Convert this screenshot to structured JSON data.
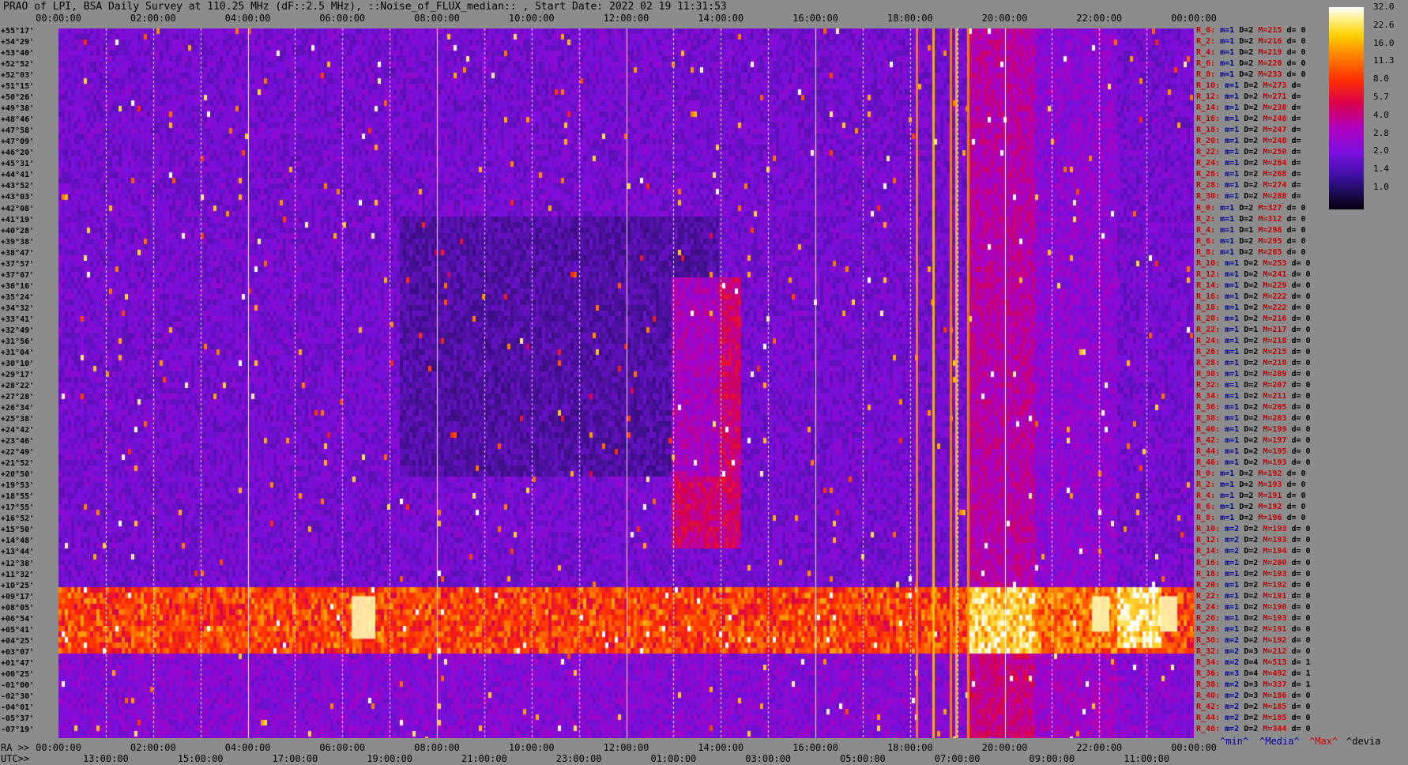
{
  "title": "PRAO of LPI, BSA Daily Survey at 110.25 MHz (dF::2.5 MHz), ::Noise_of_FLUX_median:: , Start Date: 2022 02 19 11:31:53",
  "top_times": [
    "00:00:00",
    "02:00:00",
    "04:00:00",
    "06:00:00",
    "08:00:00",
    "10:00:00",
    "12:00:00",
    "14:00:00",
    "16:00:00",
    "18:00:00",
    "20:00:00",
    "22:00:00",
    "00:00:00"
  ],
  "ra_label": "RA >>",
  "ra_times": [
    "00:00:00",
    "02:00:00",
    "04:00:00",
    "06:00:00",
    "08:00:00",
    "10:00:00",
    "12:00:00",
    "14:00:00",
    "16:00:00",
    "18:00:00",
    "20:00:00",
    "22:00:00",
    "00:00:00"
  ],
  "utc_label": "UTC>>",
  "utc_times": [
    "13:00:00",
    "15:00:00",
    "17:00:00",
    "19:00:00",
    "21:00:00",
    "23:00:00",
    "01:00:00",
    "03:00:00",
    "05:00:00",
    "07:00:00",
    "09:00:00",
    "11:00:00"
  ],
  "declinations": [
    "+55°17'",
    "+54°29'",
    "+53°40'",
    "+52°52'",
    "+52°03'",
    "+51°15'",
    "+50°26'",
    "+49°38'",
    "+48°46'",
    "+47°58'",
    "+47°09'",
    "+46°20'",
    "+45°31'",
    "+44°41'",
    "+43°52'",
    "+43°03'",
    "+42°08'",
    "+41°19'",
    "+40°28'",
    "+39°38'",
    "+38°47'",
    "+37°57'",
    "+37°07'",
    "+36°16'",
    "+35°24'",
    "+34°32'",
    "+33°41'",
    "+32°49'",
    "+31°56'",
    "+31°04'",
    "+30°10'",
    "+29°17'",
    "+28°22'",
    "+27°28'",
    "+26°34'",
    "+25°38'",
    "+24°42'",
    "+23°46'",
    "+22°49'",
    "+21°52'",
    "+20°50'",
    "+19°53'",
    "+18°55'",
    "+17°55'",
    "+16°52'",
    "+15°50'",
    "+14°48'",
    "+13°44'",
    "+12°38'",
    "+11°32'",
    "+10°25'",
    "+09°17'",
    "+08°05'",
    "+06°54'",
    "+05°41'",
    "+04°25'",
    "+03°07'",
    "+01°47'",
    "+00°25'",
    "-01°00'",
    "-02°30'",
    "-04°01'",
    "-05°37'",
    "-07°19'"
  ],
  "right_stats": [
    {
      "r": "R_0:",
      "m": "m=1",
      "d": "D=2",
      "h": "M=215",
      "dev": "d= 0"
    },
    {
      "r": "R_2:",
      "m": "m=1",
      "d": "D=2",
      "h": "M=216",
      "dev": "d= 0"
    },
    {
      "r": "R_4:",
      "m": "m=1",
      "d": "D=2",
      "h": "M=219",
      "dev": "d= 0"
    },
    {
      "r": "R_6:",
      "m": "m=1",
      "d": "D=2",
      "h": "M=220",
      "dev": "d= 0"
    },
    {
      "r": "R_8:",
      "m": "m=1",
      "d": "D=2",
      "h": "M=233",
      "dev": "d= 0"
    },
    {
      "r": "R_10:",
      "m": "m=1",
      "d": "D=2",
      "h": "M=273",
      "dev": "d="
    },
    {
      "r": "R_12:",
      "m": "m=1",
      "d": "D=2",
      "h": "M=271",
      "dev": "d="
    },
    {
      "r": "R_14:",
      "m": "m=1",
      "d": "D=2",
      "h": "M=238",
      "dev": "d="
    },
    {
      "r": "R_16:",
      "m": "m=1",
      "d": "D=2",
      "h": "M=248",
      "dev": "d="
    },
    {
      "r": "R_18:",
      "m": "m=1",
      "d": "D=2",
      "h": "M=247",
      "dev": "d="
    },
    {
      "r": "R_20:",
      "m": "m=1",
      "d": "D=2",
      "h": "M=248",
      "dev": "d="
    },
    {
      "r": "R_22:",
      "m": "m=1",
      "d": "D=2",
      "h": "M=250",
      "dev": "d="
    },
    {
      "r": "R_24:",
      "m": "m=1",
      "d": "D=2",
      "h": "M=264",
      "dev": "d="
    },
    {
      "r": "R_26:",
      "m": "m=1",
      "d": "D=2",
      "h": "M=268",
      "dev": "d="
    },
    {
      "r": "R_28:",
      "m": "m=1",
      "d": "D=2",
      "h": "M=274",
      "dev": "d="
    },
    {
      "r": "R_30:",
      "m": "m=1",
      "d": "D=2",
      "h": "M=288",
      "dev": "d="
    },
    {
      "r": "R_0:",
      "m": "m=1",
      "d": "D=2",
      "h": "M=327",
      "dev": "d= 0"
    },
    {
      "r": "R_2:",
      "m": "m=1",
      "d": "D=2",
      "h": "M=312",
      "dev": "d= 0"
    },
    {
      "r": "R_4:",
      "m": "m=1",
      "d": "D=1",
      "h": "M=296",
      "dev": "d= 0"
    },
    {
      "r": "R_6:",
      "m": "m=1",
      "d": "D=2",
      "h": "M=295",
      "dev": "d= 0"
    },
    {
      "r": "R_8:",
      "m": "m=1",
      "d": "D=2",
      "h": "M=265",
      "dev": "d= 0"
    },
    {
      "r": "R_10:",
      "m": "m=1",
      "d": "D=2",
      "h": "M=253",
      "dev": "d= 0"
    },
    {
      "r": "R_12:",
      "m": "m=1",
      "d": "D=2",
      "h": "M=241",
      "dev": "d= 0"
    },
    {
      "r": "R_14:",
      "m": "m=1",
      "d": "D=2",
      "h": "M=229",
      "dev": "d= 0"
    },
    {
      "r": "R_16:",
      "m": "m=1",
      "d": "D=2",
      "h": "M=222",
      "dev": "d= 0"
    },
    {
      "r": "R_18:",
      "m": "m=1",
      "d": "D=2",
      "h": "M=222",
      "dev": "d= 0"
    },
    {
      "r": "R_20:",
      "m": "m=1",
      "d": "D=2",
      "h": "M=216",
      "dev": "d= 0"
    },
    {
      "r": "R_22:",
      "m": "m=1",
      "d": "D=1",
      "h": "M=217",
      "dev": "d= 0"
    },
    {
      "r": "R_24:",
      "m": "m=1",
      "d": "D=2",
      "h": "M=218",
      "dev": "d= 0"
    },
    {
      "r": "R_26:",
      "m": "m=1",
      "d": "D=2",
      "h": "M=215",
      "dev": "d= 0"
    },
    {
      "r": "R_28:",
      "m": "m=1",
      "d": "D=2",
      "h": "M=210",
      "dev": "d= 0"
    },
    {
      "r": "R_30:",
      "m": "m=1",
      "d": "D=2",
      "h": "M=209",
      "dev": "d= 0"
    },
    {
      "r": "R_32:",
      "m": "m=1",
      "d": "D=2",
      "h": "M=207",
      "dev": "d= 0"
    },
    {
      "r": "R_34:",
      "m": "m=1",
      "d": "D=2",
      "h": "M=211",
      "dev": "d= 0"
    },
    {
      "r": "R_36:",
      "m": "m=1",
      "d": "D=2",
      "h": "M=205",
      "dev": "d= 0"
    },
    {
      "r": "R_38:",
      "m": "m=1",
      "d": "D=2",
      "h": "M=203",
      "dev": "d= 0"
    },
    {
      "r": "R_40:",
      "m": "m=1",
      "d": "D=2",
      "h": "M=199",
      "dev": "d= 0"
    },
    {
      "r": "R_42:",
      "m": "m=1",
      "d": "D=2",
      "h": "M=197",
      "dev": "d= 0"
    },
    {
      "r": "R_44:",
      "m": "m=1",
      "d": "D=2",
      "h": "M=195",
      "dev": "d= 0"
    },
    {
      "r": "R_46:",
      "m": "m=1",
      "d": "D=2",
      "h": "M=193",
      "dev": "d= 0"
    },
    {
      "r": "R_0:",
      "m": "m=1",
      "d": "D=2",
      "h": "M=192",
      "dev": "d= 0"
    },
    {
      "r": "R_2:",
      "m": "m=1",
      "d": "D=2",
      "h": "M=193",
      "dev": "d= 0"
    },
    {
      "r": "R_4:",
      "m": "m=1",
      "d": "D=2",
      "h": "M=191",
      "dev": "d= 0"
    },
    {
      "r": "R_6:",
      "m": "m=1",
      "d": "D=2",
      "h": "M=192",
      "dev": "d= 0"
    },
    {
      "r": "R_8:",
      "m": "m=1",
      "d": "D=2",
      "h": "M=196",
      "dev": "d= 0"
    },
    {
      "r": "R_10:",
      "m": "m=2",
      "d": "D=2",
      "h": "M=193",
      "dev": "d= 0"
    },
    {
      "r": "R_12:",
      "m": "m=2",
      "d": "D=2",
      "h": "M=193",
      "dev": "d= 0"
    },
    {
      "r": "R_14:",
      "m": "m=2",
      "d": "D=2",
      "h": "M=194",
      "dev": "d= 0"
    },
    {
      "r": "R_16:",
      "m": "m=1",
      "d": "D=2",
      "h": "M=200",
      "dev": "d= 0"
    },
    {
      "r": "R_18:",
      "m": "m=1",
      "d": "D=2",
      "h": "M=193",
      "dev": "d= 0"
    },
    {
      "r": "R_20:",
      "m": "m=1",
      "d": "D=2",
      "h": "M=192",
      "dev": "d= 0"
    },
    {
      "r": "R_22:",
      "m": "m=1",
      "d": "D=2",
      "h": "M=191",
      "dev": "d= 0"
    },
    {
      "r": "R_24:",
      "m": "m=1",
      "d": "D=2",
      "h": "M=190",
      "dev": "d= 0"
    },
    {
      "r": "R_26:",
      "m": "m=1",
      "d": "D=2",
      "h": "M=193",
      "dev": "d= 0"
    },
    {
      "r": "R_28:",
      "m": "m=1",
      "d": "D=2",
      "h": "M=191",
      "dev": "d= 0"
    },
    {
      "r": "R_30:",
      "m": "m=2",
      "d": "D=2",
      "h": "M=192",
      "dev": "d= 0"
    },
    {
      "r": "R_32:",
      "m": "m=2",
      "d": "D=3",
      "h": "M=212",
      "dev": "d= 0"
    },
    {
      "r": "R_34:",
      "m": "m=2",
      "d": "D=4",
      "h": "M=513",
      "dev": "d= 1"
    },
    {
      "r": "R_36:",
      "m": "m=3",
      "d": "D=4",
      "h": "M=492",
      "dev": "d= 1"
    },
    {
      "r": "R_38:",
      "m": "m=2",
      "d": "D=3",
      "h": "M=337",
      "dev": "d= 1"
    },
    {
      "r": "R_40:",
      "m": "m=2",
      "d": "D=3",
      "h": "M=186",
      "dev": "d= 0"
    },
    {
      "r": "R_42:",
      "m": "m=2",
      "d": "D=2",
      "h": "M=185",
      "dev": "d= 0"
    },
    {
      "r": "R_44:",
      "m": "m=2",
      "d": "D=2",
      "h": "M=185",
      "dev": "d= 0"
    },
    {
      "r": "R_46:",
      "m": "m=2",
      "d": "D=2",
      "h": "M=344",
      "dev": "d= 0"
    }
  ],
  "colorbar_ticks": [
    "32.0",
    "22.6",
    "16.0",
    "11.3",
    "8.0",
    "5.7",
    "4.0",
    "2.8",
    "2.0",
    "1.4",
    "1.0"
  ],
  "footer_legend": {
    "min": "^min^",
    "media": "^Media^",
    "max": "^Max^",
    "devia": "^devia"
  },
  "colors": {
    "background": "#8c8c8c",
    "low": "#0a0520",
    "mid": "#7a10e0",
    "high": "#ff3000",
    "peak": "#ffffff"
  }
}
